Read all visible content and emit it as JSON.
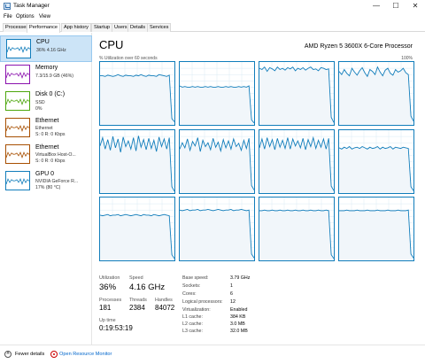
{
  "window": {
    "title": "Task Manager",
    "minimize_glyph": "—",
    "maximize_glyph": "☐",
    "close_glyph": "✕"
  },
  "menu": [
    "File",
    "Options",
    "View"
  ],
  "tabs": [
    "Processes",
    "Performance",
    "App history",
    "Startup",
    "Users",
    "Details",
    "Services"
  ],
  "active_tab": "Performance",
  "sidebar": {
    "items": [
      {
        "name": "CPU",
        "line1": "36% 4.16 GHz",
        "line2": "",
        "color": "#117dbb",
        "selected": true
      },
      {
        "name": "Memory",
        "line1": "7.3/15.9 GB (46%)",
        "line2": "",
        "color": "#8b12ae",
        "selected": false
      },
      {
        "name": "Disk 0 (C:)",
        "line1": "SSD",
        "line2": "0%",
        "color": "#4da60c",
        "selected": false
      },
      {
        "name": "Ethernet",
        "line1": "Ethernet",
        "line2": "S: 0 R: 0 Kbps",
        "color": "#a74f01",
        "selected": false
      },
      {
        "name": "Ethernet",
        "line1": "VirtualBox Host-O...",
        "line2": "S: 0 R: 0 Kbps",
        "color": "#a74f01",
        "selected": false
      },
      {
        "name": "GPU 0",
        "line1": "NVIDIA GeForce R...",
        "line2": "17% (80 °C)",
        "color": "#117dbb",
        "selected": false
      }
    ]
  },
  "main": {
    "title": "CPU",
    "model": "AMD Ryzen 5 3600X 6-Core Processor",
    "graph_caption": "% Utilization over 60 seconds",
    "graph_max": "100%",
    "graph_color": "#117dbb"
  },
  "cores": [
    [
      78,
      78,
      77,
      79,
      78,
      77,
      78,
      80,
      78,
      77,
      79,
      78,
      78,
      77,
      79,
      78,
      80,
      78,
      77,
      79,
      78,
      78,
      77,
      80,
      79,
      78,
      77,
      79,
      10,
      5
    ],
    [
      62,
      60,
      61,
      60,
      60,
      61,
      60,
      61,
      60,
      60,
      61,
      60,
      61,
      60,
      60,
      61,
      60,
      60,
      61,
      60,
      61,
      60,
      60,
      61,
      60,
      61,
      60,
      62,
      8,
      3
    ],
    [
      90,
      88,
      92,
      85,
      91,
      89,
      86,
      92,
      88,
      90,
      87,
      91,
      89,
      92,
      86,
      90,
      88,
      91,
      87,
      90,
      92,
      88,
      89,
      86,
      91,
      90,
      88,
      89,
      12,
      4
    ],
    [
      85,
      80,
      88,
      82,
      78,
      90,
      84,
      79,
      86,
      91,
      83,
      77,
      88,
      85,
      80,
      92,
      84,
      78,
      87,
      90,
      82,
      79,
      88,
      84,
      86,
      90,
      83,
      80,
      14,
      6
    ],
    [
      75,
      88,
      70,
      85,
      68,
      90,
      72,
      86,
      65,
      89,
      74,
      83,
      70,
      88,
      67,
      91,
      73,
      85,
      69,
      87,
      71,
      84,
      66,
      89,
      74,
      86,
      70,
      88,
      10,
      3
    ],
    [
      70,
      80,
      72,
      86,
      68,
      82,
      75,
      88,
      66,
      84,
      74,
      80,
      69,
      87,
      73,
      81,
      67,
      85,
      72,
      83,
      70,
      86,
      74,
      79,
      68,
      84,
      71,
      87,
      12,
      5
    ],
    [
      72,
      86,
      70,
      88,
      74,
      85,
      69,
      87,
      73,
      84,
      71,
      88,
      70,
      86,
      75,
      83,
      72,
      87,
      69,
      85,
      74,
      88,
      71,
      84,
      73,
      86,
      70,
      87,
      11,
      4
    ],
    [
      72,
      70,
      73,
      71,
      74,
      70,
      72,
      73,
      71,
      74,
      72,
      70,
      73,
      71,
      72,
      74,
      70,
      73,
      71,
      72,
      74,
      70,
      73,
      72,
      71,
      73,
      72,
      71,
      10,
      4
    ],
    [
      72,
      71,
      72,
      73,
      71,
      72,
      72,
      73,
      71,
      72,
      73,
      72,
      71,
      72,
      73,
      72,
      71,
      73,
      72,
      72,
      71,
      73,
      72,
      71,
      72,
      73,
      72,
      71,
      9,
      3
    ],
    [
      80,
      79,
      80,
      81,
      79,
      80,
      80,
      81,
      79,
      80,
      80,
      81,
      80,
      79,
      80,
      81,
      80,
      79,
      80,
      80,
      81,
      79,
      80,
      80,
      81,
      80,
      79,
      80,
      10,
      4
    ],
    [
      79,
      79,
      80,
      79,
      79,
      80,
      79,
      79,
      80,
      79,
      79,
      80,
      79,
      79,
      80,
      79,
      79,
      80,
      79,
      79,
      80,
      79,
      79,
      80,
      79,
      79,
      80,
      79,
      9,
      3
    ],
    [
      79,
      79,
      79,
      80,
      79,
      79,
      79,
      80,
      79,
      79,
      79,
      80,
      79,
      79,
      79,
      80,
      79,
      79,
      79,
      80,
      79,
      79,
      79,
      80,
      79,
      79,
      79,
      80,
      10,
      4
    ]
  ],
  "stats": {
    "utilization_label": "Utilization",
    "utilization": "36%",
    "speed_label": "Speed",
    "speed": "4.16 GHz",
    "processes_label": "Processes",
    "processes": "181",
    "threads_label": "Threads",
    "threads": "2384",
    "handles_label": "Handles",
    "handles": "84072",
    "uptime_label": "Up time",
    "uptime": "0:19:53:19"
  },
  "specs": [
    {
      "label": "Base speed:",
      "value": "3.79 GHz"
    },
    {
      "label": "Sockets:",
      "value": "1"
    },
    {
      "label": "Cores:",
      "value": "6"
    },
    {
      "label": "Logical processors:",
      "value": "12"
    },
    {
      "label": "Virtualization:",
      "value": "Enabled"
    },
    {
      "label": "L1 cache:",
      "value": "384 KB"
    },
    {
      "label": "L2 cache:",
      "value": "3.0 MB"
    },
    {
      "label": "L3 cache:",
      "value": "32.0 MB"
    }
  ],
  "footer": {
    "fewer_details": "Fewer details",
    "open_resource_monitor": "Open Resource Monitor"
  }
}
